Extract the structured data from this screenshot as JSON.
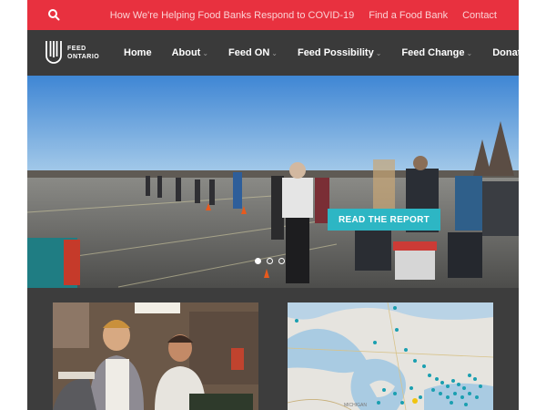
{
  "topbar": {
    "links": [
      "How We're Helping Food Banks Respond to COVID-19",
      "Find a Food Bank",
      "Contact"
    ]
  },
  "logo": {
    "line1": "FEED",
    "line2": "ONTARIO"
  },
  "nav": {
    "items": [
      {
        "label": "Home",
        "caret": false
      },
      {
        "label": "About",
        "caret": true
      },
      {
        "label": "Feed ON",
        "caret": true
      },
      {
        "label": "Feed Possibility",
        "caret": true
      },
      {
        "label": "Feed Change",
        "caret": true
      },
      {
        "label": "Donate",
        "caret": true
      }
    ],
    "caret_glyph": "⌄"
  },
  "hero": {
    "cta_label": "READ THE REPORT",
    "slide_count": 3,
    "active_slide": 1
  },
  "map": {
    "labels": [
      "MICHIGAN"
    ]
  },
  "colors": {
    "topbar": "#e8313f",
    "nav": "#3a3a3a",
    "cta": "#2db6c4",
    "map_pin": "#1a9fb0"
  }
}
